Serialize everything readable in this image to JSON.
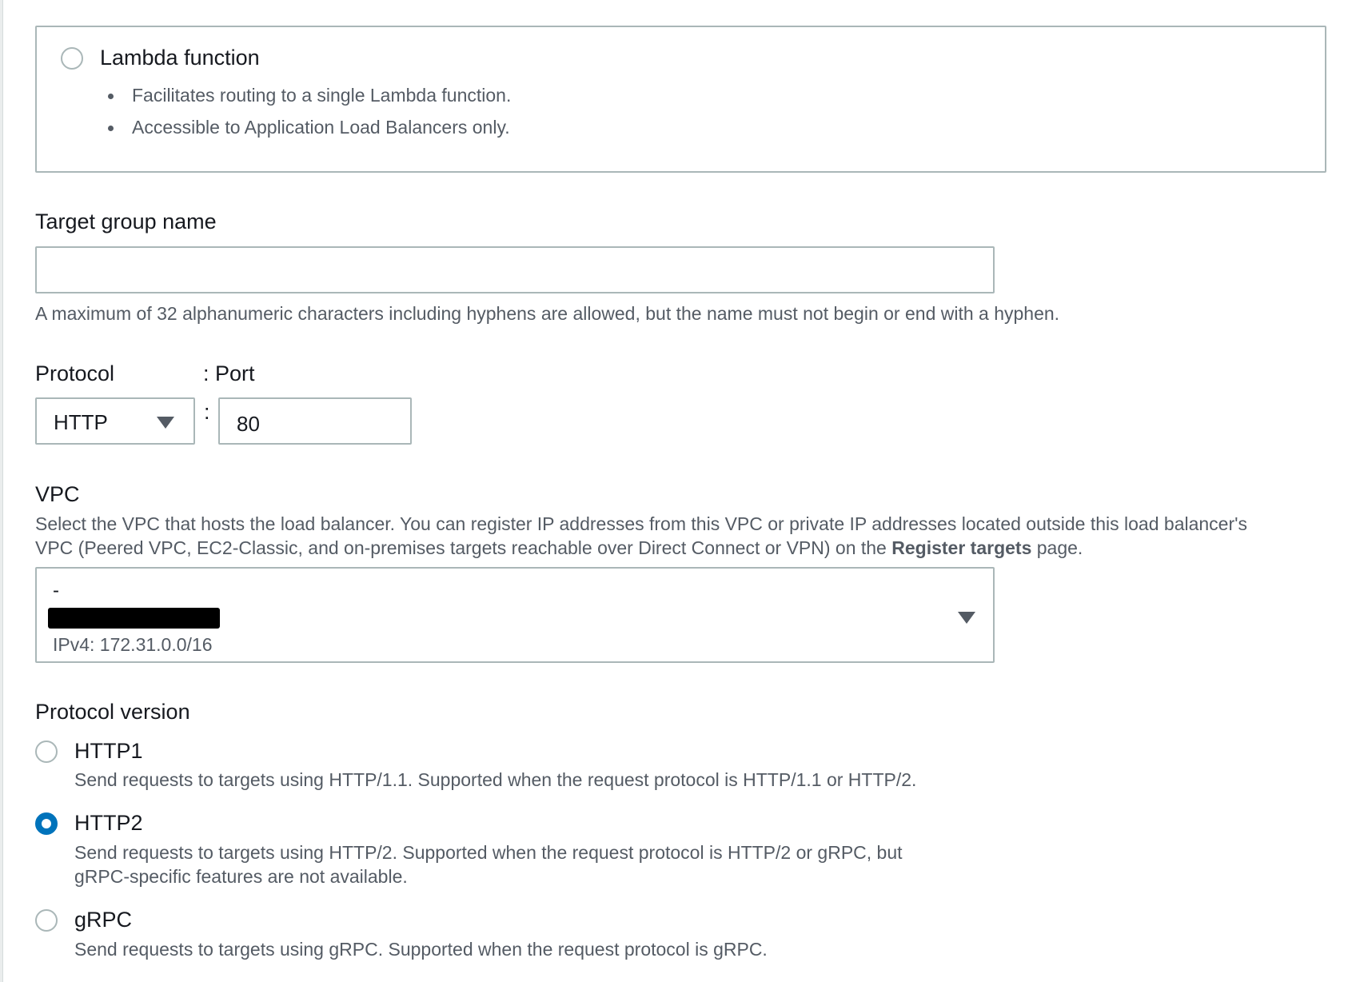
{
  "lambda_option": {
    "title": "Lambda function",
    "bullets": [
      "Facilitates routing to a single Lambda function.",
      "Accessible to Application Load Balancers only."
    ],
    "selected": false
  },
  "target_group_name": {
    "label": "Target group name",
    "value": "",
    "hint": "A maximum of 32 alphanumeric characters including hyphens are allowed, but the name must not begin or end with a hyphen."
  },
  "protocol": {
    "label": "Protocol",
    "value": "HTTP"
  },
  "port": {
    "label": ": Port",
    "separator": ":",
    "value": "80"
  },
  "vpc": {
    "label": "VPC",
    "description_1": "Select the VPC that hosts the load balancer. You can register IP addresses from this VPC or private IP addresses located outside this load balancer's",
    "description_2a": "VPC (Peered VPC, EC2-Classic, and on-premises targets reachable over Direct Connect or VPN) on the ",
    "description_2b": "Register targets",
    "description_2c": " page.",
    "selected_name": "-",
    "selected_ipv4": "IPv4: 172.31.0.0/16"
  },
  "protocol_version": {
    "label": "Protocol version",
    "options": [
      {
        "label": "HTTP1",
        "desc": "Send requests to targets using HTTP/1.1. Supported when the request protocol is HTTP/1.1 or HTTP/2.",
        "selected": false
      },
      {
        "label": "HTTP2",
        "desc": "Send requests to targets using HTTP/2. Supported when the request protocol is HTTP/2 or gRPC, but",
        "desc2": "gRPC-specific features are not available.",
        "selected": true
      },
      {
        "label": "gRPC",
        "desc": "Send requests to targets using gRPC. Supported when the request protocol is gRPC.",
        "selected": false
      }
    ]
  },
  "colors": {
    "accent": "#0073bb",
    "border": "#aab7b8",
    "text": "#16191f",
    "secondary": "#545b64"
  }
}
